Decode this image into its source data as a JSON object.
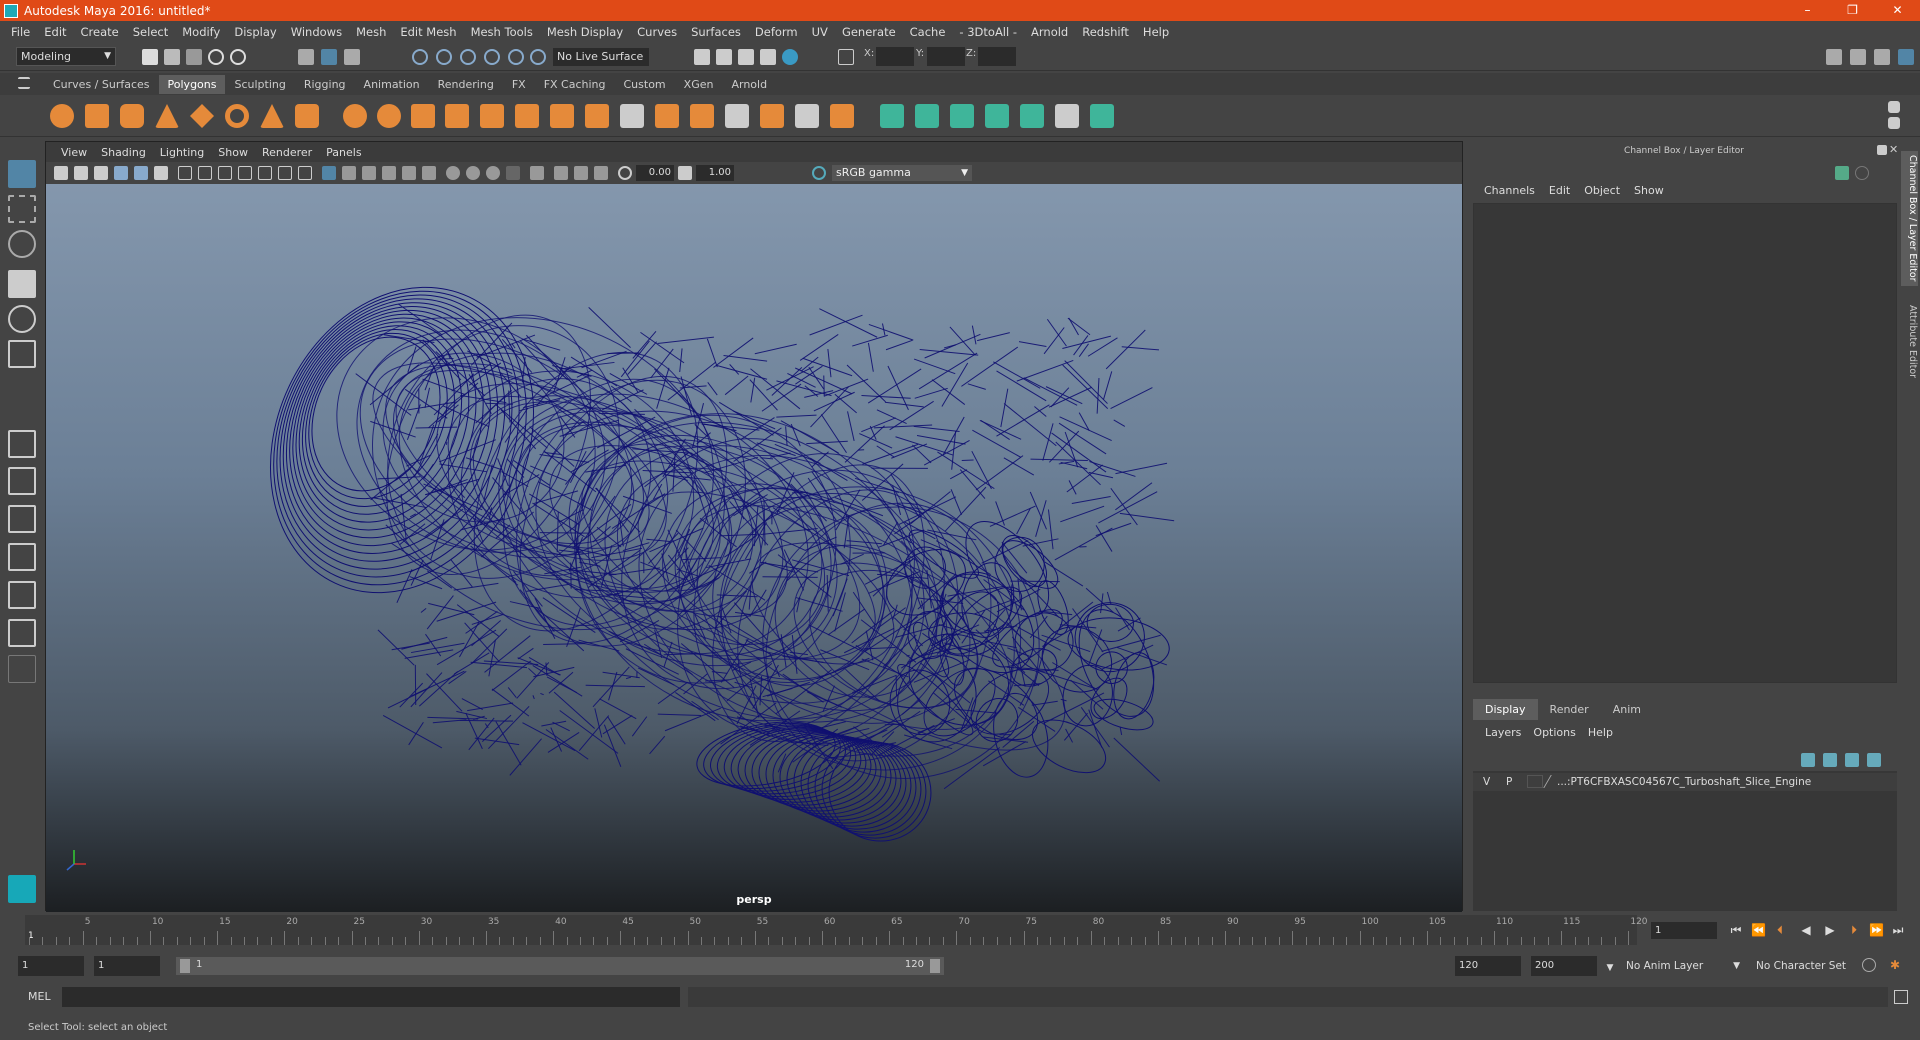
{
  "window": {
    "title": "Autodesk Maya 2016: untitled*",
    "minimize": "–",
    "maximize": "❐",
    "close": "✕"
  },
  "menubar": [
    "File",
    "Edit",
    "Create",
    "Select",
    "Modify",
    "Display",
    "Windows",
    "Mesh",
    "Edit Mesh",
    "Mesh Tools",
    "Mesh Display",
    "Curves",
    "Surfaces",
    "Deform",
    "UV",
    "Generate",
    "Cache",
    "- 3DtoAll -",
    "Arnold",
    "Redshift",
    "Help"
  ],
  "statusline": {
    "mode": "Modeling",
    "live_surface": "No Live Surface",
    "x_label": "X:",
    "y_label": "Y:",
    "z_label": "Z:"
  },
  "shelf": {
    "tabs": [
      "Curves / Surfaces",
      "Polygons",
      "Sculpting",
      "Rigging",
      "Animation",
      "Rendering",
      "FX",
      "FX Caching",
      "Custom",
      "XGen",
      "Arnold"
    ],
    "active_tab": "Polygons"
  },
  "viewport": {
    "menu": [
      "View",
      "Shading",
      "Lighting",
      "Show",
      "Renderer",
      "Panels"
    ],
    "exposure": "0.00",
    "gamma": "1.00",
    "color_space": "sRGB gamma",
    "camera": "persp",
    "wire_color": "#101070"
  },
  "channel_box": {
    "title": "Channel Box / Layer Editor",
    "menu": [
      "Channels",
      "Edit",
      "Object",
      "Show"
    ],
    "layer_tabs": [
      "Display",
      "Render",
      "Anim"
    ],
    "active_layer_tab": "Display",
    "layer_menu": [
      "Layers",
      "Options",
      "Help"
    ],
    "layers": [
      {
        "v": "V",
        "p": "P",
        "name": "...:PT6CFBXASC04567C_Turboshaft_Slice_Engine"
      }
    ]
  },
  "side_tabs": [
    "Channel Box / Layer Editor",
    "Attribute Editor"
  ],
  "timeslider": {
    "ticks": [
      "5",
      "10",
      "15",
      "20",
      "25",
      "30",
      "35",
      "40",
      "45",
      "50",
      "55",
      "60",
      "65",
      "70",
      "75",
      "80",
      "85",
      "90",
      "95",
      "100",
      "105",
      "110",
      "115",
      "120"
    ],
    "start_tick": "1",
    "current_frame": "1"
  },
  "range": {
    "start": "1",
    "playback_start": "1",
    "slider_lo": "1",
    "slider_hi": "120",
    "playback_end": "120",
    "end": "200",
    "anim_layer": "No Anim Layer",
    "character_set": "No Character Set"
  },
  "command": {
    "language": "MEL"
  },
  "help": {
    "text": "Select Tool: select an object"
  }
}
